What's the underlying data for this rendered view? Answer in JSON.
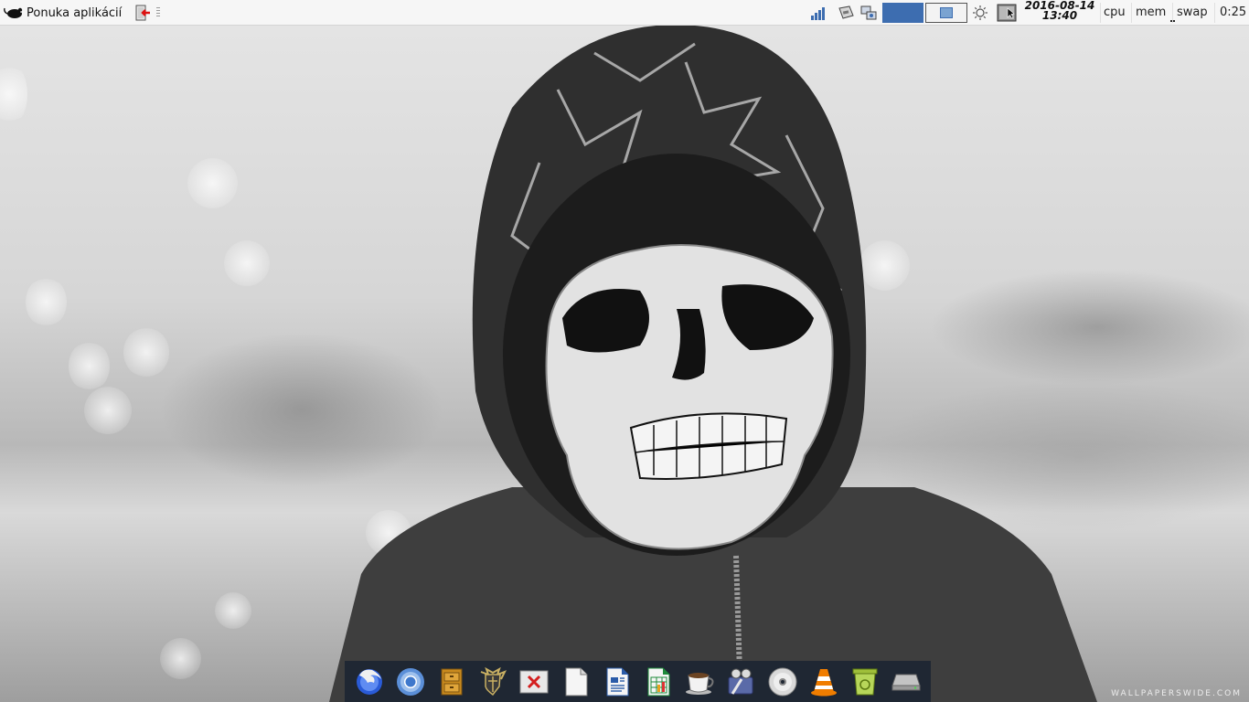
{
  "panel": {
    "app_menu_label": "Ponuka aplikácií",
    "clock_date": "2016-08-14",
    "clock_time": "13:40",
    "monitors": {
      "cpu": "cpu",
      "mem": "mem",
      "swap": "swap"
    },
    "uptime": "0:25",
    "workspaces": [
      {
        "active": true
      },
      {
        "active": false
      }
    ],
    "accent_color": "#3d6db0"
  },
  "wallpaper": {
    "watermark": "WALLPAPERSWIDE.COM"
  },
  "dock": {
    "items": [
      {
        "icon": "firefox-icon"
      },
      {
        "icon": "chromium-icon"
      },
      {
        "icon": "file-cabinet-icon"
      },
      {
        "icon": "shield-icon"
      },
      {
        "icon": "xkill-icon"
      },
      {
        "icon": "blank-document-icon"
      },
      {
        "icon": "writer-document-icon"
      },
      {
        "icon": "spreadsheet-icon"
      },
      {
        "icon": "coffee-cup-icon"
      },
      {
        "icon": "video-editor-icon"
      },
      {
        "icon": "disc-burner-icon"
      },
      {
        "icon": "vlc-icon"
      },
      {
        "icon": "trash-icon"
      },
      {
        "icon": "drive-icon"
      }
    ]
  }
}
